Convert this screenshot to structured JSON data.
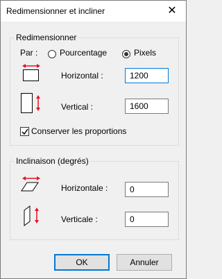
{
  "window": {
    "title": "Redimensionner et incliner",
    "close_icon": "close-icon"
  },
  "resize": {
    "legend": "Redimensionner",
    "by_label": "Par :",
    "options": [
      {
        "label": "Pourcentage",
        "selected": false
      },
      {
        "label": "Pixels",
        "selected": true
      }
    ],
    "horizontal": {
      "label": "Horizontal :",
      "value": "1200"
    },
    "vertical": {
      "label": "Vertical :",
      "value": "1600"
    },
    "keep_ratio": {
      "label": "Conserver les proportions",
      "checked": true
    }
  },
  "skew": {
    "legend": "Inclinaison (degrés)",
    "horizontal": {
      "label": "Horizontale :",
      "value": "0"
    },
    "vertical": {
      "label": "Verticale :",
      "value": "0"
    }
  },
  "buttons": {
    "ok": "OK",
    "cancel": "Annuler"
  },
  "colors": {
    "accent": "#0078d7",
    "arrow": "#e81123"
  }
}
